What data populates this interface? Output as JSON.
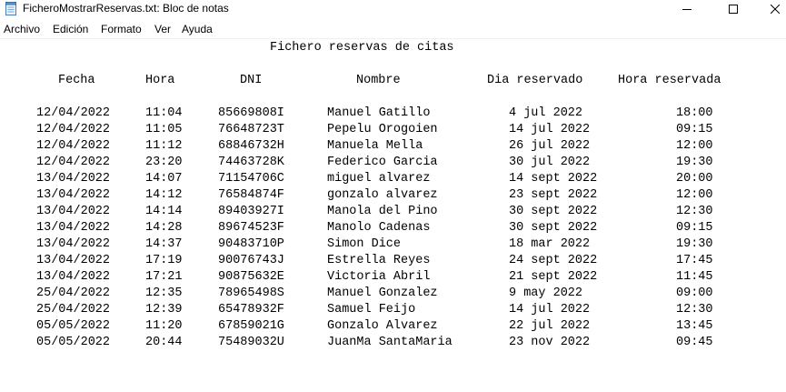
{
  "window": {
    "title": "FicheroMostrarReservas.txt: Bloc de notas"
  },
  "menu": [
    "Archivo",
    "Edición",
    "Formato",
    "Ver",
    "Ayuda"
  ],
  "document": {
    "title": "Fichero reservas de citas",
    "headers": {
      "fecha": "Fecha",
      "hora": "Hora",
      "dni": "DNI",
      "nombre": "Nombre",
      "dia": "Dia reservado",
      "hora_reservada": "Hora reservada"
    },
    "rows": [
      {
        "fecha": "12/04/2022",
        "hora": "11:04",
        "dni": "85669808I",
        "nombre": "Manuel Gatillo",
        "dia": "4 jul 2022",
        "hora_reservada": "18:00"
      },
      {
        "fecha": "12/04/2022",
        "hora": "11:05",
        "dni": "76648723T",
        "nombre": "Pepelu Orogoien",
        "dia": "14 jul 2022",
        "hora_reservada": "09:15"
      },
      {
        "fecha": "12/04/2022",
        "hora": "11:12",
        "dni": "68846732H",
        "nombre": "Manuela Mella",
        "dia": "26 jul 2022",
        "hora_reservada": "12:00"
      },
      {
        "fecha": "12/04/2022",
        "hora": "23:20",
        "dni": "74463728K",
        "nombre": "Federico Garcia",
        "dia": "30 jul 2022",
        "hora_reservada": "19:30"
      },
      {
        "fecha": "13/04/2022",
        "hora": "14:07",
        "dni": "71154706C",
        "nombre": "miguel alvarez",
        "dia": "14 sept 2022",
        "hora_reservada": "20:00"
      },
      {
        "fecha": "13/04/2022",
        "hora": "14:12",
        "dni": "76584874F",
        "nombre": "gonzalo alvarez",
        "dia": "23 sept 2022",
        "hora_reservada": "12:00"
      },
      {
        "fecha": "13/04/2022",
        "hora": "14:14",
        "dni": "89403927I",
        "nombre": "Manola del Pino",
        "dia": "30 sept 2022",
        "hora_reservada": "12:30"
      },
      {
        "fecha": "13/04/2022",
        "hora": "14:28",
        "dni": "89674523F",
        "nombre": "Manolo Cadenas",
        "dia": "30 sept 2022",
        "hora_reservada": "09:15"
      },
      {
        "fecha": "13/04/2022",
        "hora": "14:37",
        "dni": "90483710P",
        "nombre": "Simon Dice",
        "dia": "18 mar 2022",
        "hora_reservada": "19:30"
      },
      {
        "fecha": "13/04/2022",
        "hora": "17:19",
        "dni": "90076743J",
        "nombre": "Estrella Reyes",
        "dia": "24 sept 2022",
        "hora_reservada": "17:45"
      },
      {
        "fecha": "13/04/2022",
        "hora": "17:21",
        "dni": "90875632E",
        "nombre": "Victoria Abril",
        "dia": "21 sept 2022",
        "hora_reservada": "11:45"
      },
      {
        "fecha": "25/04/2022",
        "hora": "12:35",
        "dni": "78965498S",
        "nombre": "Manuel Gonzalez",
        "dia": "9 may 2022",
        "hora_reservada": "09:00"
      },
      {
        "fecha": "25/04/2022",
        "hora": "12:39",
        "dni": "65478932F",
        "nombre": "Samuel Feijo",
        "dia": "14 jul 2022",
        "hora_reservada": "12:30"
      },
      {
        "fecha": "05/05/2022",
        "hora": "11:20",
        "dni": "67859021G",
        "nombre": "Gonzalo Alvarez",
        "dia": "22 jul 2022",
        "hora_reservada": "13:45"
      },
      {
        "fecha": "05/05/2022",
        "hora": "20:44",
        "dni": "75489032U",
        "nombre": "JuanMa SantaMaria",
        "dia": "23 nov 2022",
        "hora_reservada": "09:45"
      }
    ]
  },
  "icons": {
    "app": "notepad-icon",
    "minimize": "minimize-icon",
    "maximize": "maximize-icon",
    "close": "close-icon"
  }
}
